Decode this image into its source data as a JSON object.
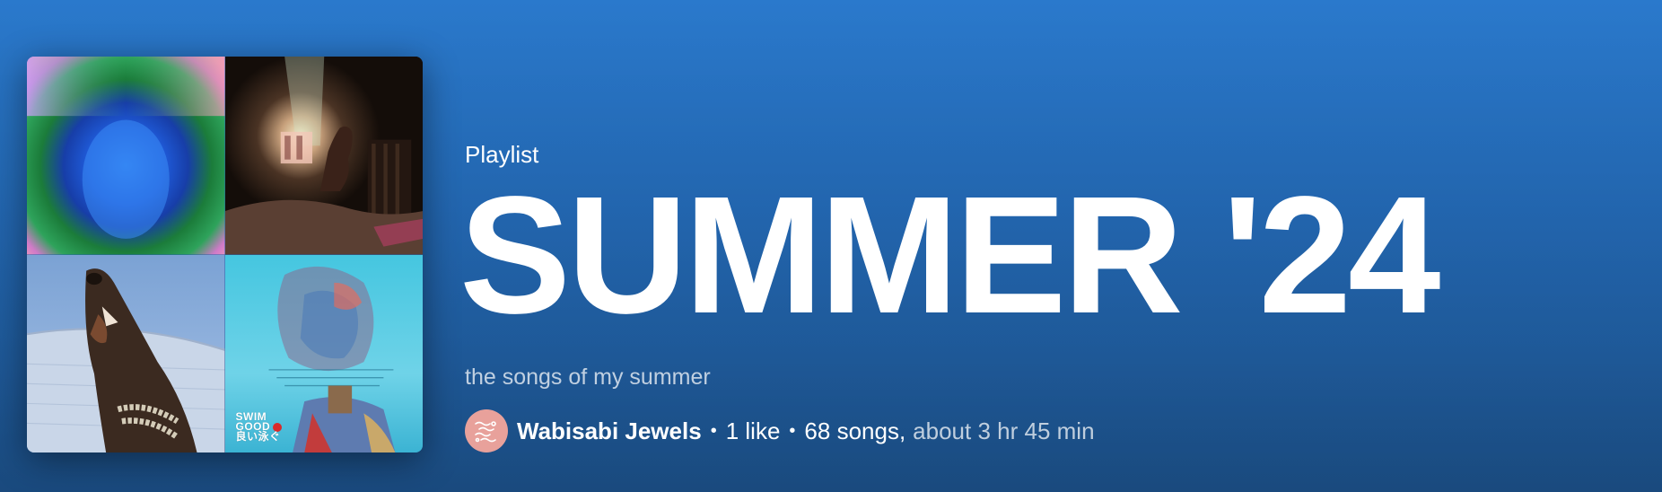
{
  "header": {
    "type_label": "Playlist",
    "title": "SUMMER '24",
    "description": "the songs of my summer"
  },
  "meta": {
    "owner": "Wabisabi Jewels",
    "separator": "•",
    "likes": "1 like",
    "songs": "68 songs,",
    "duration": "about 3 hr 45 min"
  },
  "cover": {
    "tile4_logo_line1": "SWIM",
    "tile4_logo_line2": "GOOD",
    "tile4_logo_line3": "良い泳ぐ"
  },
  "colors": {
    "background_top": "#2a79cc",
    "background_bottom": "#1d548f",
    "avatar": "#e8a19b"
  },
  "icons": {
    "avatar": "avatar-icon"
  }
}
